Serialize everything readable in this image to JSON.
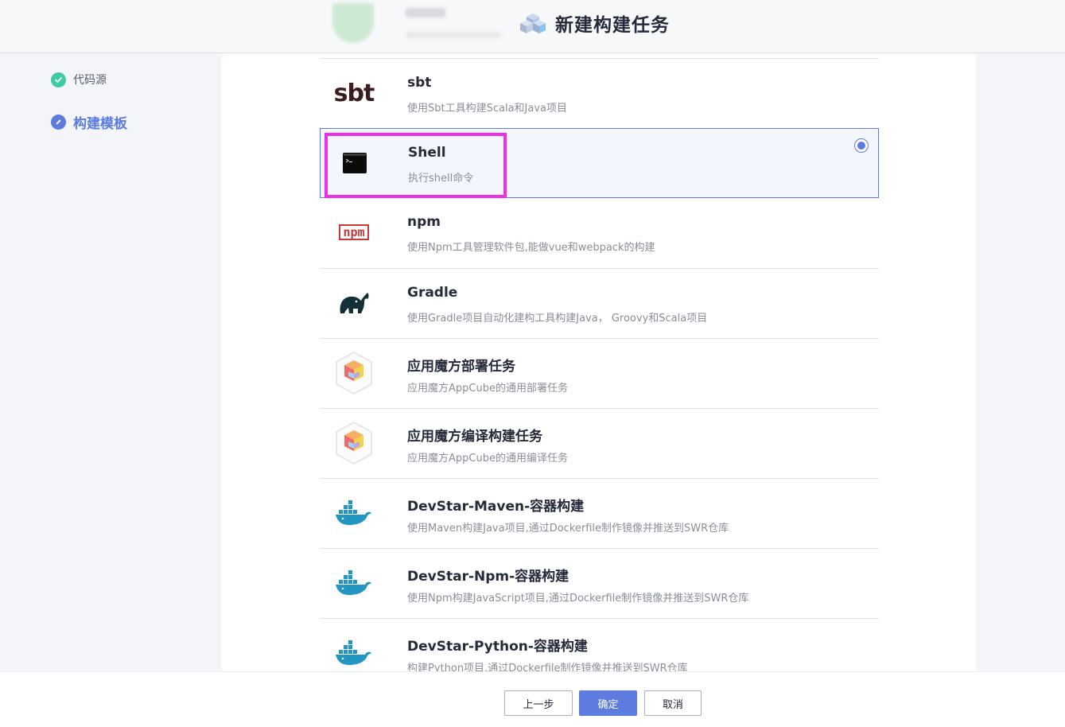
{
  "header": {
    "title": "新建构建任务"
  },
  "sidebar": {
    "steps": [
      {
        "label": "代码源",
        "status": "done"
      },
      {
        "label": "构建模板",
        "status": "active"
      }
    ]
  },
  "templates": [
    {
      "title": "sbt",
      "desc": "使用Sbt工具构建Scala和Java项目",
      "icon": "sbt-logo-icon",
      "logo_text": "sbt"
    },
    {
      "title": "Shell",
      "desc": "执行shell命令",
      "icon": "terminal-icon",
      "selected": true
    },
    {
      "title": "npm",
      "desc": "使用Npm工具管理软件包,能做vue和webpack的构建",
      "icon": "npm-logo-icon",
      "logo_text": "npm"
    },
    {
      "title": "Gradle",
      "desc": "使用Gradle项目自动化建构工具构建Java， Groovy和Scala项目",
      "icon": "gradle-elephant-icon"
    },
    {
      "title": "应用魔方部署任务",
      "desc": "应用魔方AppCube的通用部署任务",
      "icon": "appcube-icon"
    },
    {
      "title": "应用魔方编译构建任务",
      "desc": "应用魔方AppCube的通用编译任务",
      "icon": "appcube-icon"
    },
    {
      "title": "DevStar-Maven-容器构建",
      "desc": "使用Maven构建Java项目,通过Dockerfile制作镜像并推送到SWR仓库",
      "icon": "docker-whale-icon"
    },
    {
      "title": "DevStar-Npm-容器构建",
      "desc": "使用Npm构建JavaScript项目,通过Dockerfile制作镜像并推送到SWR仓库",
      "icon": "docker-whale-icon"
    },
    {
      "title": "DevStar-Python-容器构建",
      "desc": "构建Python项目,通过Dockerfile制作镜像并推送到SWR仓库",
      "icon": "docker-whale-icon"
    }
  ],
  "footer": {
    "prev_label": "上一步",
    "ok_label": "确定",
    "cancel_label": "取消"
  },
  "colors": {
    "primary": "#5e7ce0",
    "success": "#3dcca6",
    "highlight": "#ee2ee8",
    "text": "#252b3a",
    "desc": "#8a8e99"
  }
}
